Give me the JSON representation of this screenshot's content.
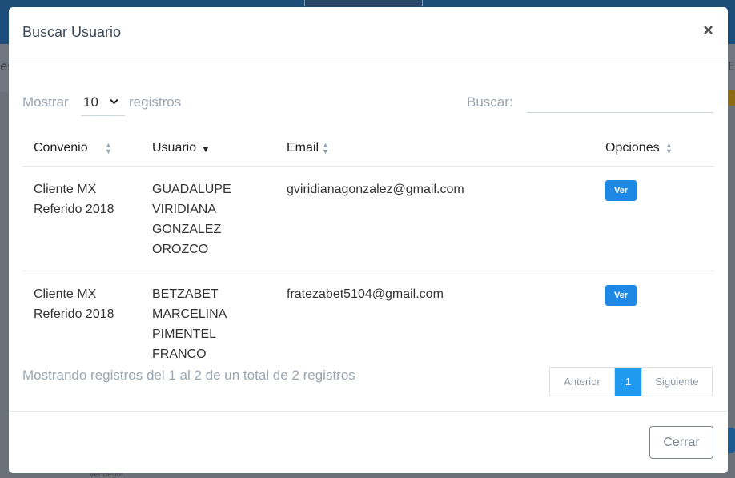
{
  "background": {
    "left_fragment": "es",
    "right_fragment": "E",
    "footer_fragment": "vendedor"
  },
  "modal": {
    "title": "Buscar Usuario",
    "close_glyph": "×"
  },
  "controls": {
    "length_prefix": "Mostrar",
    "length_value": "10",
    "length_suffix": "registros",
    "search_label": "Buscar:",
    "search_value": ""
  },
  "table": {
    "columns": [
      "Convenio",
      "Usuario",
      "Email",
      "Opciones"
    ],
    "rows": [
      {
        "convenio": [
          "Cliente MX",
          "Referido 2018"
        ],
        "usuario": [
          "GUADALUPE",
          "VIRIDIANA",
          "GONZALEZ",
          "OROZCO"
        ],
        "email": "gviridianagonzalez@gmail.com",
        "action": "Ver"
      },
      {
        "convenio": [
          "Cliente MX",
          "Referido 2018"
        ],
        "usuario": [
          "BETZABET",
          "MARCELINA",
          "PIMENTEL FRANCO"
        ],
        "email": "fratezabet5104@gmail.com",
        "action": "Ver"
      }
    ]
  },
  "info_text": "Mostrando registros del 1 al 2 de un total de 2 registros",
  "pagination": {
    "previous": "Anterior",
    "current": "1",
    "next": "Siguiente"
  },
  "footer": {
    "close_label": "Cerrar"
  },
  "colors": {
    "primary_button": "#1e88e5",
    "active_page": "#1e9bf0",
    "header_bar": "#1d4e7a"
  }
}
